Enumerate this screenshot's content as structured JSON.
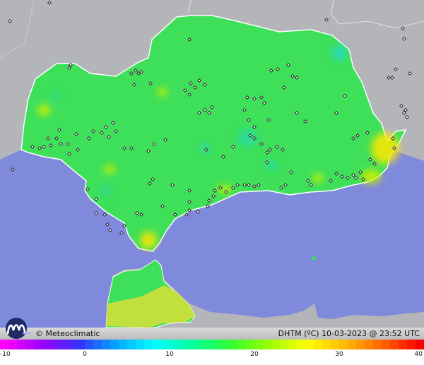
{
  "colors": {
    "sea": "#7f8adc",
    "land_outside": "#b4b5b8",
    "region_fill": "#3ee05a",
    "border": "#ffffff",
    "station_marker": "#111111"
  },
  "map": {
    "regions": [
      "Andalusia",
      "Northern Morocco"
    ],
    "stations": "weather station markers",
    "overlay_icon": "station-marker-icon"
  },
  "footer": {
    "brand": "© Meteoclimatic",
    "caption": "DHTM (ºC)  10-03-2023 @ 23:52 UTC",
    "logo_icon": "meteoclimatic-logo-icon"
  },
  "scale": {
    "unit": "ºC",
    "min": -10,
    "max": 40,
    "ticks": [
      "-10",
      "0",
      "10",
      "20",
      "30",
      "40"
    ],
    "tick_values": [
      -10,
      0,
      10,
      20,
      30,
      40
    ],
    "gradient_stops": [
      "#ff00ff",
      "#9d00ff",
      "#3333ff",
      "#00aaff",
      "#00ffff",
      "#00ff99",
      "#33ff33",
      "#99ff00",
      "#ffff00",
      "#ffbb00",
      "#ff6600",
      "#ff0000"
    ]
  }
}
